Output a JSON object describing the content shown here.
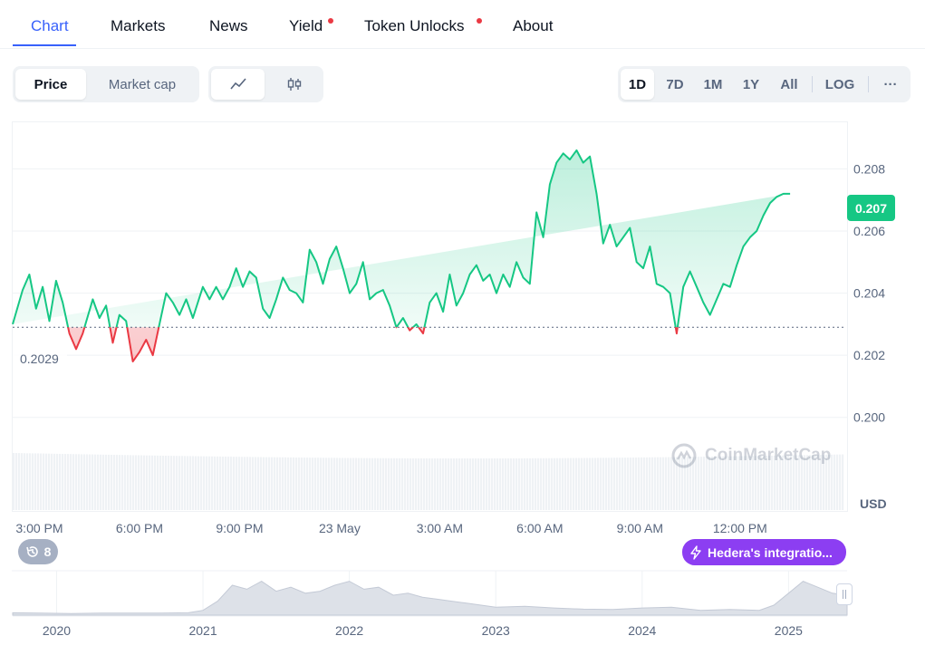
{
  "tabs": [
    {
      "label": "Chart",
      "active": true,
      "dot": false
    },
    {
      "label": "Markets",
      "active": false,
      "dot": false
    },
    {
      "label": "News",
      "active": false,
      "dot": false
    },
    {
      "label": "Yield",
      "active": false,
      "dot": true
    },
    {
      "label": "Token Unlocks",
      "active": false,
      "dot": true
    },
    {
      "label": "About",
      "active": false,
      "dot": false
    }
  ],
  "toggles": {
    "metric": {
      "options": [
        "Price",
        "Market cap"
      ],
      "selected": "Price"
    },
    "style": {
      "options": [
        "line-chart-icon",
        "candlestick-icon"
      ],
      "selected": "line-chart-icon"
    },
    "range": {
      "options": [
        "1D",
        "7D",
        "1M",
        "1Y",
        "All"
      ],
      "selected": "1D",
      "log_label": "LOG",
      "more_label": "···"
    }
  },
  "colors": {
    "up": "#16c784",
    "down": "#ea3943",
    "accent": "#3861fb",
    "news": "#8c3ef2"
  },
  "chart_data": {
    "type": "line",
    "title": "",
    "currency": "USD",
    "current_price": "0.207",
    "reference_price": "0.2029",
    "reference_value": 0.2029,
    "ylim": [
      0.199,
      0.2095
    ],
    "y_ticks": [
      "0.208",
      "0.206",
      "0.204",
      "0.202",
      "0.200"
    ],
    "y_tick_values": [
      0.208,
      0.206,
      0.204,
      0.202,
      0.2
    ],
    "x_ticks": [
      "3:00 PM",
      "6:00 PM",
      "9:00 PM",
      "23 May",
      "3:00 AM",
      "6:00 AM",
      "9:00 AM",
      "12:00 PM"
    ],
    "x_tick_hours": [
      3,
      6,
      9,
      12,
      15,
      18,
      21,
      24
    ],
    "x_hour_range": [
      2.2,
      27.1
    ],
    "series": [
      {
        "x_hours": [
          2.2,
          2.5,
          2.7,
          2.9,
          3.1,
          3.3,
          3.5,
          3.7,
          3.9,
          4.1,
          4.3,
          4.6,
          4.8,
          5.0,
          5.2,
          5.4,
          5.6,
          5.8,
          6.0,
          6.2,
          6.4,
          6.6,
          6.8,
          7.0,
          7.2,
          7.4,
          7.6,
          7.9,
          8.1,
          8.3,
          8.5,
          8.7,
          8.9,
          9.1,
          9.3,
          9.5,
          9.7,
          9.9,
          10.1,
          10.3,
          10.5,
          10.7,
          10.9,
          11.1,
          11.3,
          11.5,
          11.7,
          11.9,
          12.1,
          12.3,
          12.5,
          12.7,
          12.9,
          13.1,
          13.3,
          13.5,
          13.7,
          13.9,
          14.1,
          14.3,
          14.5,
          14.7,
          14.9,
          15.1,
          15.3,
          15.5,
          15.7,
          15.9,
          16.1,
          16.3,
          16.5,
          16.7,
          16.9,
          17.1,
          17.3,
          17.5,
          17.7,
          17.9,
          18.1,
          18.3,
          18.5,
          18.7,
          18.9,
          19.1,
          19.3,
          19.5,
          19.7,
          19.9,
          20.1,
          20.3,
          20.5,
          20.7,
          20.9,
          21.1,
          21.3,
          21.5,
          21.7,
          21.9,
          22.1,
          22.3,
          22.5,
          22.7,
          22.9,
          23.1,
          23.3,
          23.5,
          23.7,
          23.9,
          24.1,
          24.3,
          24.5,
          24.7,
          24.9,
          25.1,
          25.3,
          25.5,
          25.7,
          25.9,
          26.1,
          26.3,
          26.5,
          26.7,
          26.9,
          27.1
        ],
        "values": [
          0.203,
          0.2041,
          0.2046,
          0.2035,
          0.2042,
          0.2031,
          0.2044,
          0.2037,
          0.2027,
          0.2022,
          0.2027,
          0.2038,
          0.2032,
          0.2036,
          0.2024,
          0.2033,
          0.2031,
          0.2018,
          0.2021,
          0.2025,
          0.202,
          0.203,
          0.204,
          0.2037,
          0.2033,
          0.2038,
          0.2032,
          0.2042,
          0.2038,
          0.2042,
          0.2038,
          0.2042,
          0.2048,
          0.2042,
          0.2047,
          0.2045,
          0.2035,
          0.2032,
          0.2038,
          0.2045,
          0.2041,
          0.204,
          0.2037,
          0.2054,
          0.205,
          0.2043,
          0.2051,
          0.2055,
          0.2048,
          0.204,
          0.2043,
          0.205,
          0.2038,
          0.204,
          0.2041,
          0.2036,
          0.2029,
          0.2032,
          0.2028,
          0.203,
          0.2027,
          0.2037,
          0.204,
          0.2034,
          0.2046,
          0.2036,
          0.204,
          0.2046,
          0.2049,
          0.2044,
          0.2046,
          0.204,
          0.2046,
          0.2042,
          0.205,
          0.2045,
          0.2043,
          0.2066,
          0.2058,
          0.2075,
          0.2082,
          0.2085,
          0.2083,
          0.2086,
          0.2082,
          0.2084,
          0.2072,
          0.2056,
          0.2062,
          0.2055,
          0.2058,
          0.2061,
          0.205,
          0.2048,
          0.2055,
          0.2043,
          0.2042,
          0.204,
          0.2027,
          0.2042,
          0.2047,
          0.2042,
          0.2037,
          0.2033,
          0.2038,
          0.2043,
          0.2042,
          0.2049,
          0.2055,
          0.2058,
          0.206,
          0.2065,
          0.2069,
          0.2071,
          0.2072,
          0.2072
        ]
      }
    ]
  },
  "labels": {
    "usd": "USD",
    "brand": "CoinMarketCap",
    "history_count": "8",
    "news_event": "Hedera's integratio..."
  },
  "overview": {
    "years": [
      "2020",
      "2021",
      "2022",
      "2023",
      "2024",
      "2025"
    ],
    "year_positions": [
      2020.0,
      2021.0,
      2022.0,
      2023.0,
      2024.0,
      2025.0
    ],
    "x_range": [
      2019.7,
      2025.4
    ],
    "t": [
      2019.7,
      2019.9,
      2020.1,
      2020.3,
      2020.5,
      2020.7,
      2020.9,
      2021.0,
      2021.1,
      2021.2,
      2021.3,
      2021.4,
      2021.5,
      2021.6,
      2021.7,
      2021.8,
      2021.9,
      2022.0,
      2022.1,
      2022.2,
      2022.3,
      2022.4,
      2022.5,
      2022.6,
      2022.7,
      2022.8,
      2022.9,
      2023.0,
      2023.2,
      2023.4,
      2023.6,
      2023.8,
      2024.0,
      2024.2,
      2024.4,
      2024.6,
      2024.8,
      2024.9,
      2025.0,
      2025.1,
      2025.2,
      2025.3,
      2025.4
    ],
    "v": [
      0.06,
      0.05,
      0.04,
      0.05,
      0.05,
      0.05,
      0.06,
      0.12,
      0.35,
      0.75,
      0.65,
      0.85,
      0.6,
      0.7,
      0.55,
      0.6,
      0.75,
      0.85,
      0.65,
      0.7,
      0.5,
      0.55,
      0.45,
      0.4,
      0.35,
      0.3,
      0.25,
      0.2,
      0.22,
      0.18,
      0.15,
      0.14,
      0.18,
      0.2,
      0.12,
      0.14,
      0.12,
      0.25,
      0.55,
      0.85,
      0.7,
      0.55,
      0.5
    ]
  }
}
